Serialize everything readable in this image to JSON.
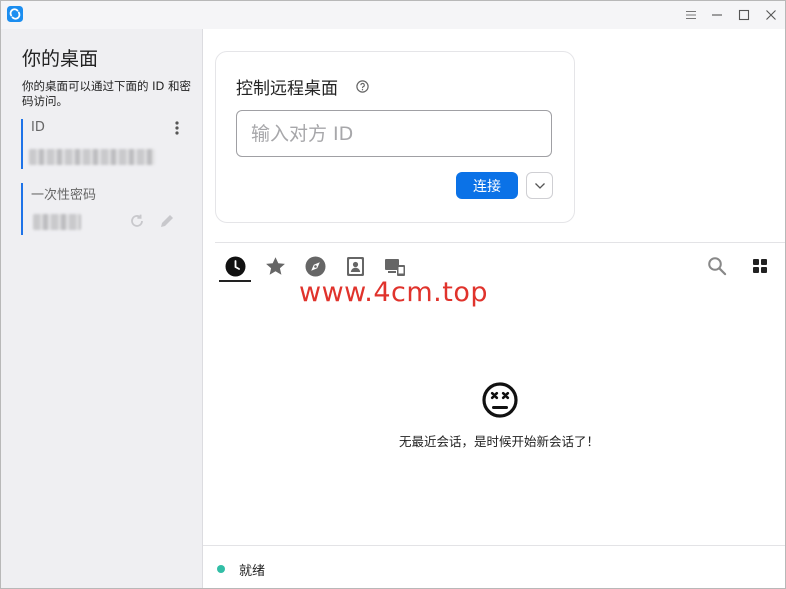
{
  "app": {
    "accent": "#0b72e7"
  },
  "sidebar": {
    "title": "你的桌面",
    "description": "你的桌面可以通过下面的 ID 和密码访问。",
    "id_label": "ID",
    "password_label": "一次性密码"
  },
  "connect": {
    "title": "控制远程桌面",
    "placeholder": "输入对方 ID",
    "connect_label": "连接"
  },
  "tabs": [
    {
      "name": "recent",
      "icon": "clock-icon"
    },
    {
      "name": "favorites",
      "icon": "star-icon"
    },
    {
      "name": "discovered",
      "icon": "compass-icon"
    },
    {
      "name": "address-book",
      "icon": "contact-book-icon"
    },
    {
      "name": "groups",
      "icon": "devices-icon"
    }
  ],
  "watermark": "www.4cm.top",
  "empty": {
    "message": "无最近会话，是时候开始新会话了！"
  },
  "status": {
    "text": "就绪",
    "color": "#32bea6"
  }
}
